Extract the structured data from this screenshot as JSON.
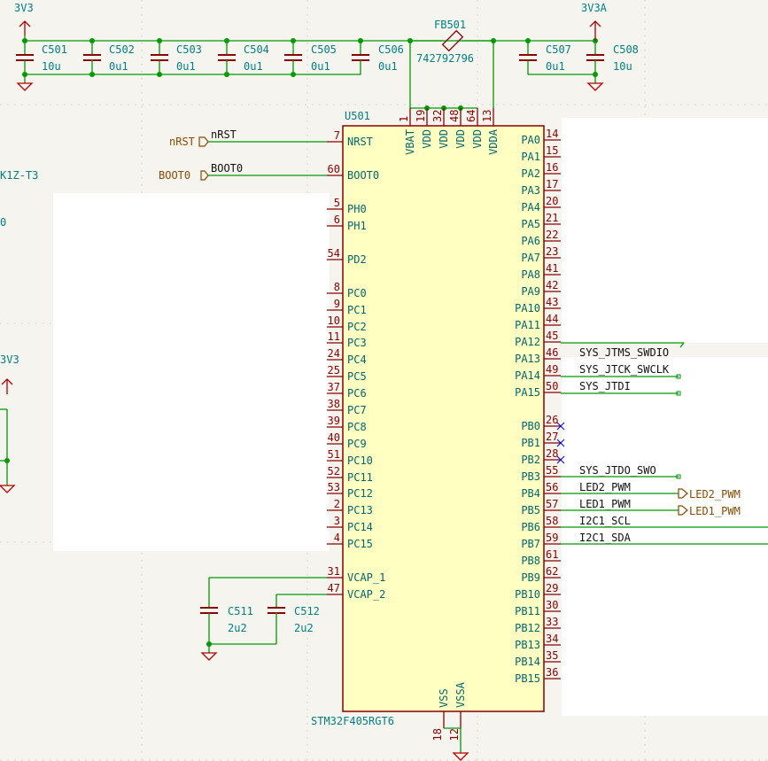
{
  "power": {
    "rail_3v3": "3V3",
    "rail_3v3a": "3V3A",
    "rail_3v3_left": "3V3"
  },
  "capacitors": [
    {
      "ref": "C501",
      "value": "10u"
    },
    {
      "ref": "C502",
      "value": "0u1"
    },
    {
      "ref": "C503",
      "value": "0u1"
    },
    {
      "ref": "C504",
      "value": "0u1"
    },
    {
      "ref": "C505",
      "value": "0u1"
    },
    {
      "ref": "C506",
      "value": "0u1"
    },
    {
      "ref": "C507",
      "value": "0u1"
    },
    {
      "ref": "C508",
      "value": "10u"
    },
    {
      "ref": "C511",
      "value": "2u2"
    },
    {
      "ref": "C512",
      "value": "2u2"
    }
  ],
  "ferrite": {
    "ref": "FB501",
    "value": "742792796"
  },
  "ic": {
    "ref": "U501",
    "part": "STM32F405RGT6",
    "top_pins": [
      {
        "num": "1",
        "name": "VBAT"
      },
      {
        "num": "19",
        "name": "VDD"
      },
      {
        "num": "32",
        "name": "VDD"
      },
      {
        "num": "48",
        "name": "VDD"
      },
      {
        "num": "64",
        "name": "VDD"
      },
      {
        "num": "13",
        "name": "VDDA"
      }
    ],
    "bottom_pins": [
      {
        "num": "18",
        "name": "VSS"
      },
      {
        "num": "12",
        "name": "VSSA"
      }
    ],
    "left_pins": [
      {
        "num": "7",
        "name": "NRST"
      },
      {
        "num": "60",
        "name": "BOOT0"
      },
      {
        "num": "5",
        "name": "PH0"
      },
      {
        "num": "6",
        "name": "PH1"
      },
      {
        "num": "54",
        "name": "PD2"
      },
      {
        "num": "8",
        "name": "PC0"
      },
      {
        "num": "9",
        "name": "PC1"
      },
      {
        "num": "10",
        "name": "PC2"
      },
      {
        "num": "11",
        "name": "PC3"
      },
      {
        "num": "24",
        "name": "PC4"
      },
      {
        "num": "25",
        "name": "PC5"
      },
      {
        "num": "37",
        "name": "PC6"
      },
      {
        "num": "38",
        "name": "PC7"
      },
      {
        "num": "39",
        "name": "PC8"
      },
      {
        "num": "40",
        "name": "PC9"
      },
      {
        "num": "51",
        "name": "PC10"
      },
      {
        "num": "52",
        "name": "PC11"
      },
      {
        "num": "53",
        "name": "PC12"
      },
      {
        "num": "2",
        "name": "PC13"
      },
      {
        "num": "3",
        "name": "PC14"
      },
      {
        "num": "4",
        "name": "PC15"
      },
      {
        "num": "31",
        "name": "VCAP_1"
      },
      {
        "num": "47",
        "name": "VCAP_2"
      }
    ],
    "right_pins": [
      {
        "num": "14",
        "name": "PA0"
      },
      {
        "num": "15",
        "name": "PA1"
      },
      {
        "num": "16",
        "name": "PA2"
      },
      {
        "num": "17",
        "name": "PA3"
      },
      {
        "num": "20",
        "name": "PA4"
      },
      {
        "num": "21",
        "name": "PA5"
      },
      {
        "num": "22",
        "name": "PA6"
      },
      {
        "num": "23",
        "name": "PA7"
      },
      {
        "num": "41",
        "name": "PA8"
      },
      {
        "num": "42",
        "name": "PA9"
      },
      {
        "num": "43",
        "name": "PA10"
      },
      {
        "num": "44",
        "name": "PA11"
      },
      {
        "num": "45",
        "name": "PA12"
      },
      {
        "num": "46",
        "name": "PA13"
      },
      {
        "num": "49",
        "name": "PA14"
      },
      {
        "num": "50",
        "name": "PA15"
      },
      {
        "num": "26",
        "name": "PB0"
      },
      {
        "num": "27",
        "name": "PB1"
      },
      {
        "num": "28",
        "name": "PB2"
      },
      {
        "num": "55",
        "name": "PB3"
      },
      {
        "num": "56",
        "name": "PB4"
      },
      {
        "num": "57",
        "name": "PB5"
      },
      {
        "num": "58",
        "name": "PB6"
      },
      {
        "num": "59",
        "name": "PB7"
      },
      {
        "num": "61",
        "name": "PB8"
      },
      {
        "num": "62",
        "name": "PB9"
      },
      {
        "num": "29",
        "name": "PB10"
      },
      {
        "num": "30",
        "name": "PB11"
      },
      {
        "num": "33",
        "name": "PB12"
      },
      {
        "num": "34",
        "name": "PB13"
      },
      {
        "num": "35",
        "name": "PB14"
      },
      {
        "num": "36",
        "name": "PB15"
      }
    ]
  },
  "nets": {
    "nrst_wire": "nRST",
    "nrst_global": "nRST",
    "boot0_wire": "BOOT0",
    "boot0_global": "BOOT0",
    "swdio": "SYS_JTMS_SWDIO",
    "swclk": "SYS_JTCK_SWCLK",
    "jtdi": "SYS_JTDI",
    "jtdo": "SYS_JTDO_SWO",
    "led2_wire": "LED2_PWM",
    "led1_wire": "LED1_PWM",
    "led2_global": "LED2_PWM",
    "led1_global": "LED1_PWM",
    "scl": "I2C1_SCL",
    "sda": "I2C1_SDA"
  },
  "offpage": {
    "left_ref_fragment": "K1Z-T3",
    "left_value_fragment": "0"
  },
  "colors": {
    "wire": "#009900",
    "pin": "#8b0000",
    "ic_fill": "#ffffc2",
    "ic_border": "#8b0000",
    "text_ref": "#008080",
    "global_label": "#8a4b00",
    "background": "#f5f4ef",
    "blank_panel": "#ffffff",
    "no_connect": "#0000cc"
  }
}
